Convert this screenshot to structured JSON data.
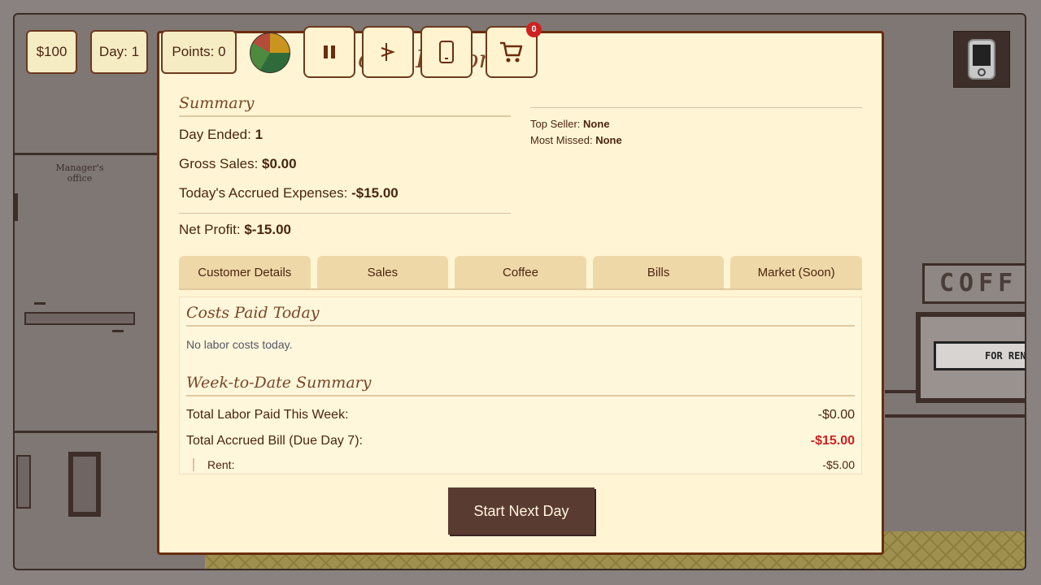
{
  "hud": {
    "money": "$100",
    "day": "Day: 1",
    "points": "Points: 0",
    "cart_count": "0"
  },
  "icons": {
    "pause": "pause-icon",
    "skip": "skip-forward-icon",
    "phone": "phone-icon",
    "cart": "shopping-cart-icon",
    "wheel": "spin-wheel-icon"
  },
  "scene": {
    "manager_office_line1": "Manager's",
    "manager_office_line2": "office",
    "coffee_sign": "COFF",
    "rent_sign": "FOR RENT"
  },
  "report": {
    "title": "otry Report",
    "summary_title": "Summary",
    "day_ended_label": "Day Ended:",
    "day_ended_value": "1",
    "gross_sales_label": "Gross Sales:",
    "gross_sales_value": "$0.00",
    "accrued_label": "Today's Accrued Expenses:",
    "accrued_value": "-$15.00",
    "net_profit_label": "Net Profit:",
    "net_profit_value": "$-15.00",
    "top_seller_label": "Top Seller:",
    "top_seller_value": "None",
    "most_missed_label": "Most Missed:",
    "most_missed_value": "None"
  },
  "tabs": [
    "Customer Details",
    "Sales",
    "Coffee",
    "Bills",
    "Market (Soon)"
  ],
  "bills": {
    "costs_title": "Costs Paid Today",
    "no_labor": "No labor costs today.",
    "week_title": "Week-to-Date Summary",
    "labor_label": "Total Labor Paid This Week:",
    "labor_value": "-$0.00",
    "accrued_label": "Total Accrued Bill (Due Day 7):",
    "accrued_value": "-$15.00",
    "rent_label": "Rent:",
    "rent_value": "-$5.00"
  },
  "next_button": "Start Next Day",
  "colors": {
    "accent_red": "#d02020",
    "panel": "#fff5d4",
    "button": "#5a3b32"
  }
}
